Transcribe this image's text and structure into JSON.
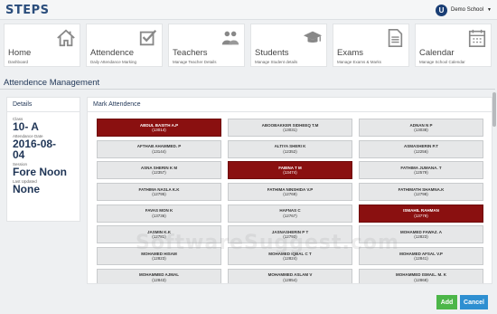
{
  "app": {
    "brand": "STEPS",
    "user_initial": "U",
    "user_name": "Demo School"
  },
  "tiles": [
    {
      "title": "Home",
      "subtitle": "Dashboard",
      "icon": "home-icon"
    },
    {
      "title": "Attendence",
      "subtitle": "Daily Attendance Marking",
      "icon": "checkbox-icon"
    },
    {
      "title": "Teachers",
      "subtitle": "Manage Teacher Details",
      "icon": "teachers-icon"
    },
    {
      "title": "Students",
      "subtitle": "Manage Student details",
      "icon": "graduation-cap-icon"
    },
    {
      "title": "Exams",
      "subtitle": "Manage Exams & Marks",
      "icon": "document-icon"
    },
    {
      "title": "Calendar",
      "subtitle": "Manage School Calendar",
      "icon": "calendar-icon"
    }
  ],
  "section": {
    "title": "Attendence Management"
  },
  "details": {
    "heading": "Details",
    "class_label": "Class",
    "class_value": "10- A",
    "date_label": "Attendance Date",
    "date_value_line1": "2016-08-",
    "date_value_line2": "04",
    "session_label": "Session",
    "session_value": "Fore Noon",
    "updated_label": "Last Updated",
    "updated_value": "None"
  },
  "attendance": {
    "heading": "Mark Attendence",
    "students": [
      {
        "name": "ABDUL BASITH A.P",
        "id": "(13014)",
        "absent": true
      },
      {
        "name": "ABOOBAKKER SIDHEEQ T.M",
        "id": "(13031)",
        "absent": false
      },
      {
        "name": "ADNAN N P",
        "id": "(13038)",
        "absent": false
      },
      {
        "name": "AFTHAB AHAMMED. P",
        "id": "(13144)",
        "absent": false
      },
      {
        "name": "ALTIYA SHERI K",
        "id": "(12352)",
        "absent": false
      },
      {
        "name": "ASMASHERIN P.T",
        "id": "(12256)",
        "absent": false
      },
      {
        "name": "ASNA SHERIN K M",
        "id": "(12357)",
        "absent": false
      },
      {
        "name": "FABINA T M",
        "id": "(13474)",
        "absent": true
      },
      {
        "name": "FATHIMA JUMANA. T",
        "id": "(12579)",
        "absent": false
      },
      {
        "name": "FATHIMA NASLA K.K",
        "id": "(12795)",
        "absent": false
      },
      {
        "name": "FATHIMA NINSHIDA V.P",
        "id": "(12769)",
        "absent": false
      },
      {
        "name": "FATHIMATH SHAMNA.K",
        "id": "(12798)",
        "absent": false
      },
      {
        "name": "FAVAS MON K",
        "id": "(13736)",
        "absent": false
      },
      {
        "name": "HAFNAS C",
        "id": "(12767)",
        "absent": false
      },
      {
        "name": "ISMAHIL RAHMAN",
        "id": "(13779)",
        "absent": true
      },
      {
        "name": "JASMIN K.K",
        "id": "(12781)",
        "absent": false
      },
      {
        "name": "JASNASHERIN P T",
        "id": "(12793)",
        "absent": false
      },
      {
        "name": "MOHAMED FAWAZ. A",
        "id": "(12823)",
        "absent": false
      },
      {
        "name": "MOHAMED HISAM",
        "id": "(12823)",
        "absent": false
      },
      {
        "name": "MOHAMED IQBAL C T",
        "id": "(12824)",
        "absent": false
      },
      {
        "name": "MOHAMED AFSAL V.P",
        "id": "(12841)",
        "absent": false
      },
      {
        "name": "MOHAMMED AJMAL",
        "id": "(12843)",
        "absent": false
      },
      {
        "name": "MOHAMMED ASLAM V",
        "id": "(12854)",
        "absent": false
      },
      {
        "name": "MOHAMMED ISMAIL. M. K",
        "id": "(12868)",
        "absent": false
      }
    ]
  },
  "actions": {
    "add_label": "Add",
    "cancel_label": "Cancel"
  },
  "watermark": "SoftwareSuggest.com",
  "colors": {
    "brand": "#2a4d7c",
    "absent": "#8a1010",
    "add": "#4cb649",
    "cancel": "#2e8fd1"
  }
}
